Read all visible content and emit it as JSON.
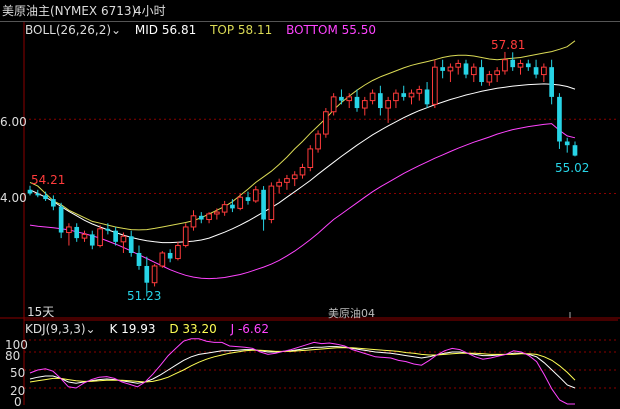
{
  "header": {
    "title": "美原油主(NYMEX 6713)",
    "period": "4小时"
  },
  "boll": {
    "name": "BOLL(26,26,2)",
    "mid_label": "MID",
    "mid_value": "56.81",
    "top_label": "TOP",
    "top_value": "58.11",
    "bottom_label": "BOTTOM",
    "bottom_value": "55.50"
  },
  "kdj": {
    "name": "KDJ(9,3,3)",
    "k_label": "K",
    "k_value": "19.93",
    "d_label": "D",
    "d_value": "33.20",
    "j_label": "J",
    "j_value": "-6.62"
  },
  "main_axis_ticks": [
    "6.00",
    "4.00"
  ],
  "kdj_axis_ticks": [
    "100",
    "80",
    "50",
    "20",
    "0"
  ],
  "annotations": {
    "left_high": "54.21",
    "low": "51.23",
    "high": "57.81",
    "last": "55.02",
    "range_label": "15天",
    "watermark": "美原油04"
  },
  "colors": {
    "up": "#ff3b3b",
    "down": "#27d4e6",
    "top": "#dada55",
    "mid": "#ffffff",
    "bottom": "#ff44ff",
    "k": "#ffffff",
    "d": "#ffff55",
    "j": "#ff44ff",
    "grid": "#8b0000"
  },
  "chart_data": [
    {
      "type": "candlestick",
      "title": "BOLL(26,26,2)",
      "ylim": [
        51.0,
        58.4
      ],
      "candles": [
        [
          54.1,
          54.21,
          53.95,
          54.0
        ],
        [
          54.0,
          54.1,
          53.9,
          53.95
        ],
        [
          53.95,
          54.05,
          53.8,
          53.85
        ],
        [
          53.85,
          53.95,
          53.55,
          53.65
        ],
        [
          53.65,
          53.75,
          52.8,
          52.95
        ],
        [
          52.95,
          53.2,
          52.6,
          53.1
        ],
        [
          53.1,
          53.2,
          52.7,
          52.8
        ],
        [
          52.8,
          53.0,
          52.7,
          52.9
        ],
        [
          52.9,
          53.0,
          52.5,
          52.6
        ],
        [
          52.6,
          53.15,
          52.55,
          53.05
        ],
        [
          53.05,
          53.2,
          52.9,
          53.0
        ],
        [
          53.0,
          53.1,
          52.6,
          52.7
        ],
        [
          52.7,
          52.95,
          52.4,
          52.85
        ],
        [
          52.85,
          53.0,
          52.3,
          52.4
        ],
        [
          52.4,
          52.6,
          51.95,
          52.05
        ],
        [
          52.05,
          52.3,
          51.23,
          51.6
        ],
        [
          51.6,
          52.1,
          51.5,
          52.05
        ],
        [
          52.05,
          52.45,
          52.0,
          52.4
        ],
        [
          52.4,
          52.5,
          52.15,
          52.25
        ],
        [
          52.25,
          52.7,
          52.2,
          52.6
        ],
        [
          52.6,
          53.2,
          52.55,
          53.1
        ],
        [
          53.1,
          53.55,
          53.0,
          53.4
        ],
        [
          53.4,
          53.5,
          53.2,
          53.3
        ],
        [
          53.3,
          53.5,
          53.2,
          53.45
        ],
        [
          53.45,
          53.6,
          53.3,
          53.5
        ],
        [
          53.5,
          53.8,
          53.4,
          53.7
        ],
        [
          53.7,
          53.85,
          53.5,
          53.6
        ],
        [
          53.6,
          54.0,
          53.55,
          53.9
        ],
        [
          53.9,
          54.05,
          53.7,
          53.8
        ],
        [
          53.8,
          54.2,
          53.75,
          54.1
        ],
        [
          54.1,
          54.2,
          53.0,
          53.3
        ],
        [
          53.3,
          54.3,
          53.2,
          54.2
        ],
        [
          54.2,
          54.4,
          54.0,
          54.3
        ],
        [
          54.3,
          54.5,
          54.1,
          54.4
        ],
        [
          54.4,
          54.6,
          54.2,
          54.5
        ],
        [
          54.5,
          54.8,
          54.4,
          54.7
        ],
        [
          54.7,
          55.3,
          54.6,
          55.2
        ],
        [
          55.2,
          55.7,
          55.1,
          55.6
        ],
        [
          55.6,
          56.3,
          55.5,
          56.2
        ],
        [
          56.2,
          56.7,
          56.1,
          56.6
        ],
        [
          56.6,
          56.8,
          56.4,
          56.5
        ],
        [
          56.5,
          56.7,
          56.3,
          56.6
        ],
        [
          56.6,
          56.8,
          56.2,
          56.3
        ],
        [
          56.3,
          56.6,
          56.1,
          56.5
        ],
        [
          56.5,
          56.8,
          56.4,
          56.7
        ],
        [
          56.7,
          56.9,
          56.1,
          56.3
        ],
        [
          56.3,
          56.6,
          55.9,
          56.5
        ],
        [
          56.5,
          56.8,
          56.3,
          56.7
        ],
        [
          56.7,
          56.9,
          56.5,
          56.6
        ],
        [
          56.6,
          56.8,
          56.4,
          56.7
        ],
        [
          56.7,
          56.9,
          56.5,
          56.8
        ],
        [
          56.8,
          57.0,
          56.3,
          56.4
        ],
        [
          56.4,
          57.6,
          56.3,
          57.4
        ],
        [
          57.4,
          57.6,
          57.1,
          57.3
        ],
        [
          57.3,
          57.5,
          57.0,
          57.4
        ],
        [
          57.4,
          57.6,
          57.2,
          57.5
        ],
        [
          57.5,
          57.6,
          57.1,
          57.2
        ],
        [
          57.2,
          57.5,
          57.0,
          57.4
        ],
        [
          57.4,
          57.6,
          56.9,
          57.0
        ],
        [
          57.0,
          57.3,
          56.9,
          57.2
        ],
        [
          57.2,
          57.4,
          57.0,
          57.3
        ],
        [
          57.3,
          57.81,
          57.2,
          57.6
        ],
        [
          57.6,
          57.8,
          57.3,
          57.4
        ],
        [
          57.4,
          57.6,
          57.2,
          57.5
        ],
        [
          57.5,
          57.6,
          57.3,
          57.4
        ],
        [
          57.4,
          57.6,
          57.1,
          57.2
        ],
        [
          57.2,
          57.5,
          57.0,
          57.4
        ],
        [
          57.4,
          57.6,
          56.4,
          56.6
        ],
        [
          56.6,
          56.7,
          55.2,
          55.4
        ],
        [
          55.4,
          55.5,
          55.1,
          55.3
        ],
        [
          55.3,
          55.4,
          55.0,
          55.02
        ]
      ],
      "series": [
        {
          "name": "TOP",
          "values": [
            54.3,
            54.2,
            54.0,
            53.8,
            53.7,
            53.55,
            53.45,
            53.35,
            53.25,
            53.2,
            53.15,
            53.1,
            53.06,
            53.03,
            53.02,
            53.03,
            53.06,
            53.1,
            53.14,
            53.18,
            53.22,
            53.27,
            53.35,
            53.45,
            53.55,
            53.65,
            53.78,
            53.95,
            54.12,
            54.3,
            54.45,
            54.6,
            54.78,
            54.98,
            55.2,
            55.4,
            55.62,
            55.82,
            56.02,
            56.25,
            56.45,
            56.62,
            56.78,
            56.92,
            57.04,
            57.14,
            57.22,
            57.3,
            57.38,
            57.45,
            57.5,
            57.55,
            57.6,
            57.66,
            57.7,
            57.72,
            57.72,
            57.7,
            57.66,
            57.62,
            57.6,
            57.62,
            57.64,
            57.66,
            57.7,
            57.74,
            57.78,
            57.82,
            57.88,
            57.95,
            58.11
          ]
        },
        {
          "name": "MID",
          "values": [
            54.1,
            54.0,
            53.9,
            53.78,
            53.65,
            53.52,
            53.4,
            53.28,
            53.18,
            53.1,
            53.02,
            52.95,
            52.88,
            52.82,
            52.77,
            52.73,
            52.7,
            52.68,
            52.68,
            52.69,
            52.7,
            52.72,
            52.75,
            52.8,
            52.88,
            52.96,
            53.05,
            53.15,
            53.26,
            53.38,
            53.5,
            53.62,
            53.75,
            53.9,
            54.05,
            54.2,
            54.35,
            54.52,
            54.68,
            54.84,
            55.0,
            55.15,
            55.3,
            55.44,
            55.58,
            55.7,
            55.82,
            55.93,
            56.04,
            56.14,
            56.23,
            56.31,
            56.39,
            56.46,
            56.53,
            56.59,
            56.65,
            56.7,
            56.75,
            56.79,
            56.83,
            56.86,
            56.89,
            56.91,
            56.93,
            56.94,
            56.95,
            56.94,
            56.92,
            56.88,
            56.81
          ]
        },
        {
          "name": "BOTTOM",
          "values": [
            53.15,
            53.12,
            53.1,
            53.08,
            53.05,
            53.02,
            52.97,
            52.92,
            52.86,
            52.8,
            52.72,
            52.64,
            52.55,
            52.45,
            52.35,
            52.25,
            52.15,
            52.05,
            51.95,
            51.87,
            51.8,
            51.75,
            51.72,
            51.71,
            51.72,
            51.74,
            51.78,
            51.82,
            51.88,
            51.95,
            52.02,
            52.1,
            52.2,
            52.32,
            52.45,
            52.6,
            52.76,
            52.93,
            53.12,
            53.3,
            53.45,
            53.6,
            53.75,
            53.9,
            54.05,
            54.18,
            54.3,
            54.42,
            54.54,
            54.65,
            54.75,
            54.85,
            54.95,
            55.04,
            55.13,
            55.22,
            55.3,
            55.38,
            55.45,
            55.52,
            55.6,
            55.66,
            55.72,
            55.76,
            55.8,
            55.83,
            55.86,
            55.88,
            55.7,
            55.55,
            55.5
          ]
        }
      ]
    },
    {
      "type": "line",
      "title": "KDJ(9,3,3)",
      "ylim": [
        0,
        100
      ],
      "series": [
        {
          "name": "K",
          "values": [
            35,
            38,
            40,
            40,
            36,
            30,
            28,
            30,
            32,
            34,
            35,
            34,
            32,
            30,
            28,
            30,
            35,
            42,
            50,
            58,
            66,
            72,
            76,
            78,
            80,
            82,
            82,
            83,
            84,
            84,
            82,
            80,
            80,
            81,
            82,
            84,
            86,
            88,
            88,
            89,
            89,
            88,
            86,
            84,
            82,
            80,
            79,
            78,
            76,
            74,
            72,
            70,
            72,
            75,
            78,
            80,
            80,
            78,
            76,
            74,
            74,
            75,
            76,
            78,
            78,
            76,
            72,
            62,
            50,
            38,
            25,
            19.93
          ]
        },
        {
          "name": "D",
          "values": [
            30,
            32,
            34,
            36,
            36,
            34,
            32,
            31,
            31,
            32,
            33,
            33,
            33,
            32,
            31,
            30,
            31,
            34,
            38,
            44,
            50,
            57,
            63,
            68,
            72,
            75,
            78,
            80,
            82,
            83,
            83,
            82,
            81,
            81,
            81,
            82,
            83,
            84,
            85,
            86,
            87,
            87,
            87,
            86,
            85,
            84,
            83,
            82,
            81,
            79,
            78,
            76,
            75,
            75,
            76,
            77,
            78,
            78,
            78,
            77,
            76,
            76,
            76,
            76,
            77,
            77,
            76,
            72,
            66,
            57,
            46,
            33.2
          ]
        },
        {
          "name": "J",
          "values": [
            45,
            50,
            52,
            48,
            36,
            22,
            20,
            28,
            34,
            38,
            39,
            36,
            30,
            26,
            22,
            30,
            43,
            58,
            74,
            86,
            98,
            102,
            102,
            98,
            96,
            96,
            90,
            89,
            88,
            86,
            80,
            76,
            78,
            81,
            84,
            88,
            92,
            96,
            94,
            95,
            93,
            90,
            84,
            80,
            76,
            72,
            71,
            70,
            66,
            64,
            60,
            58,
            66,
            75,
            82,
            86,
            84,
            78,
            72,
            68,
            70,
            73,
            76,
            82,
            80,
            74,
            64,
            42,
            18,
            0,
            -6.62,
            -6.62
          ]
        }
      ]
    }
  ]
}
